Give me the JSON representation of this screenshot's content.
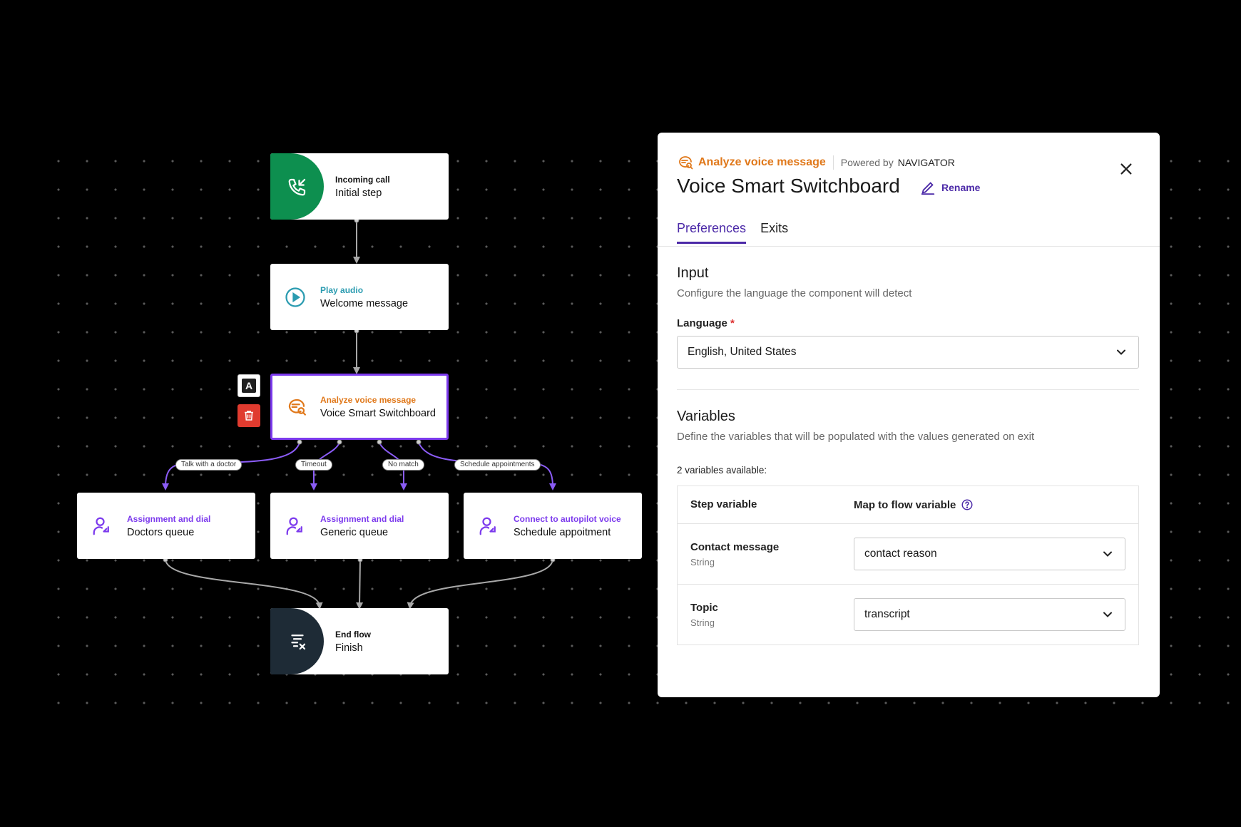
{
  "flow": {
    "nodes": {
      "incoming": {
        "category": "Incoming call",
        "name": "Initial step",
        "icon": "phone-incoming-icon"
      },
      "play": {
        "category": "Play audio",
        "name": "Welcome message",
        "icon": "play-circle-icon"
      },
      "analyze": {
        "category": "Analyze voice message",
        "name": "Voice Smart Switchboard",
        "icon": "voice-analyze-icon"
      },
      "doctors": {
        "category": "Assignment and dial",
        "name": "Doctors queue",
        "icon": "agent-dial-icon"
      },
      "generic": {
        "category": "Assignment and dial",
        "name": "Generic queue",
        "icon": "agent-dial-icon"
      },
      "autopilot": {
        "category": "Connect to autopilot voice",
        "name": "Schedule appoitment",
        "icon": "agent-dial-icon"
      },
      "end": {
        "category": "End flow",
        "name": "Finish",
        "icon": "end-flow-icon"
      }
    },
    "edge_labels": [
      "Talk with a doctor",
      "Timeout",
      "No match",
      "Schedule appointments"
    ],
    "side_tools": {
      "label_button": "A"
    },
    "colors": {
      "start": "#0d8f4f",
      "end": "#1e2b36",
      "accent": "#7c3aed",
      "analyze": "#e0781a",
      "play": "#2a9bb0",
      "delete": "#e03b2f"
    }
  },
  "panel": {
    "category": "Analyze voice message",
    "powered_by_label": "Powered by",
    "powered_by_name": "NAVIGATOR",
    "title": "Voice Smart Switchboard",
    "rename_label": "Rename",
    "tabs": [
      {
        "label": "Preferences",
        "active": true
      },
      {
        "label": "Exits",
        "active": false
      }
    ],
    "input": {
      "title": "Input",
      "description": "Configure the language the component will detect",
      "language_label": "Language",
      "required_mark": "*",
      "language_value": "English, United States"
    },
    "variables": {
      "title": "Variables",
      "description": "Define the variables that will be populated with the values generated on exit",
      "count_text": "2 variables available:",
      "col_step": "Step variable",
      "col_map": "Map to flow variable",
      "rows": [
        {
          "name": "Contact message",
          "type": "String",
          "mapped": "contact reason"
        },
        {
          "name": "Topic",
          "type": "String",
          "mapped": "transcript"
        }
      ]
    }
  }
}
